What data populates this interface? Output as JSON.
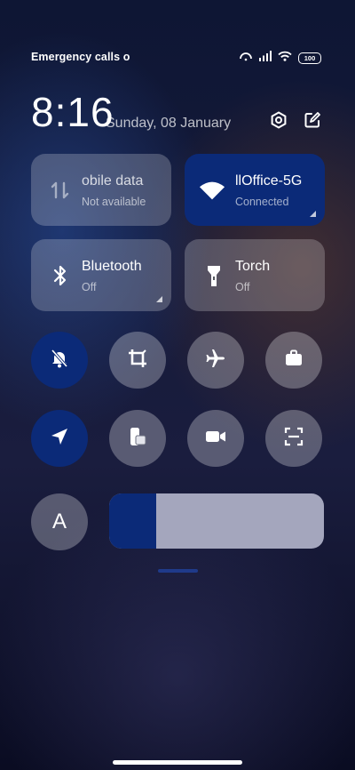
{
  "status_bar": {
    "carrier_text": "Emergency calls o",
    "battery": "100",
    "icons": [
      "hotspot-icon",
      "signal-icon",
      "wifi-icon",
      "battery-icon"
    ]
  },
  "header": {
    "time": "8:16",
    "date": "Sunday, 08 January",
    "settings_icon": "settings-icon",
    "edit_icon": "edit-icon"
  },
  "tiles": {
    "mobile_data": {
      "title": "obile data",
      "subtitle": "Not available",
      "icon": "mobile-data-icon"
    },
    "wifi": {
      "title": "llOffice-5G",
      "subtitle": "Connected",
      "icon": "wifi-icon",
      "active": true
    },
    "bluetooth": {
      "title": "Bluetooth",
      "subtitle": "Off",
      "icon": "bluetooth-icon"
    },
    "torch": {
      "title": "Torch",
      "subtitle": "Off",
      "icon": "torch-icon"
    }
  },
  "toggles": [
    {
      "name": "mute",
      "icon": "bell-off-icon",
      "active": true
    },
    {
      "name": "screenshot",
      "icon": "crop-icon",
      "active": false
    },
    {
      "name": "airplane-mode",
      "icon": "airplane-icon",
      "active": false
    },
    {
      "name": "work-mode",
      "icon": "briefcase-icon",
      "active": false
    },
    {
      "name": "location",
      "icon": "location-arrow-icon",
      "active": true
    },
    {
      "name": "floating-window",
      "icon": "floating-window-icon",
      "active": false
    },
    {
      "name": "screen-recorder",
      "icon": "video-camera-icon",
      "active": false
    },
    {
      "name": "scanner",
      "icon": "scan-icon",
      "active": false
    }
  ],
  "brightness": {
    "auto_label": "A",
    "level": 0.22
  },
  "colors": {
    "accent": "#0b2a78",
    "tile_inactive": "rgba(255,255,255,0.22)",
    "slider_track": "#a4a6bd"
  }
}
